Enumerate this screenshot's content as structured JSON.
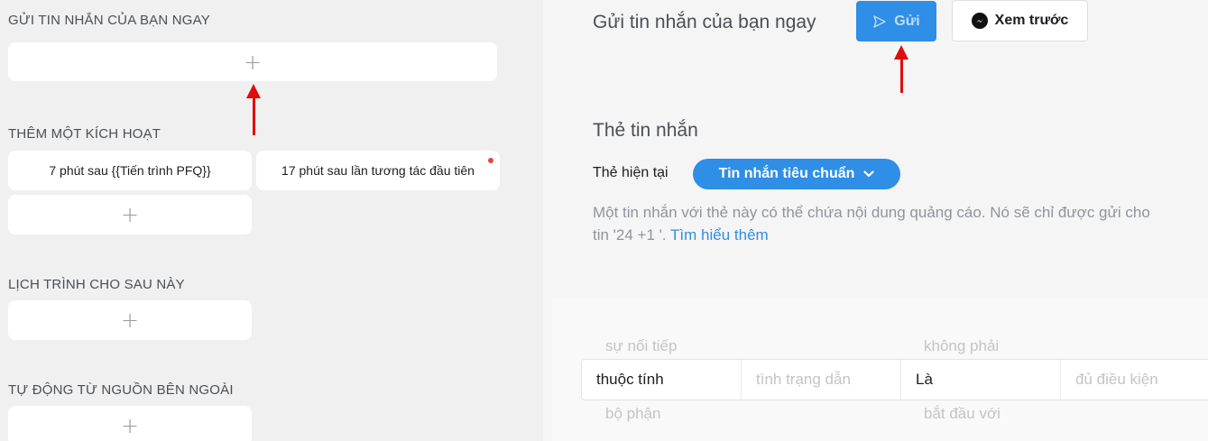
{
  "left": {
    "send_now_title": "GỬI TIN NHẮN CỦA BẠN NGAY",
    "trigger_title": "THÊM MỘT KÍCH HOẠT",
    "triggers": [
      "7 phút sau {{Tiến trình PFQ}}",
      "17 phút sau lần tương tác đầu tiên"
    ],
    "schedule_title": "LỊCH TRÌNH CHO SAU NÀY",
    "external_title": "TỰ ĐỘNG TỪ NGUỒN BÊN NGOÀI",
    "add_symbol": "+"
  },
  "header": {
    "title": "Gửi tin nhắn của bạn ngay",
    "send_label": "Gửi",
    "preview_label": "Xem trước"
  },
  "tag": {
    "title": "Thẻ tin nhắn",
    "current_label": "Thẻ hiện tại",
    "current_value": "Tin nhắn tiêu chuẩn",
    "desc_line1": "Một tin nhắn với thẻ này có thể chứa nội dung quảng cáo. Nó sẽ chỉ được gửi cho",
    "desc_line2": "tin '24 +1 '. ",
    "learn_more": "Tìm hiểu thêm"
  },
  "filter": {
    "ghost_top_left": "sự nối tiếp",
    "ghost_top_right": "không phải",
    "attribute": "thuộc tính",
    "condition_placeholder": "tình trạng dẫn",
    "operator": "Là",
    "value_placeholder": "đủ điều kiện",
    "ghost_bottom_left": "bộ phận",
    "ghost_bottom_right": "bắt đầu với"
  },
  "colors": {
    "accent": "#2f8ee6",
    "annotation_arrow": "#e00d0d",
    "notification_dot": "#e0473c"
  }
}
